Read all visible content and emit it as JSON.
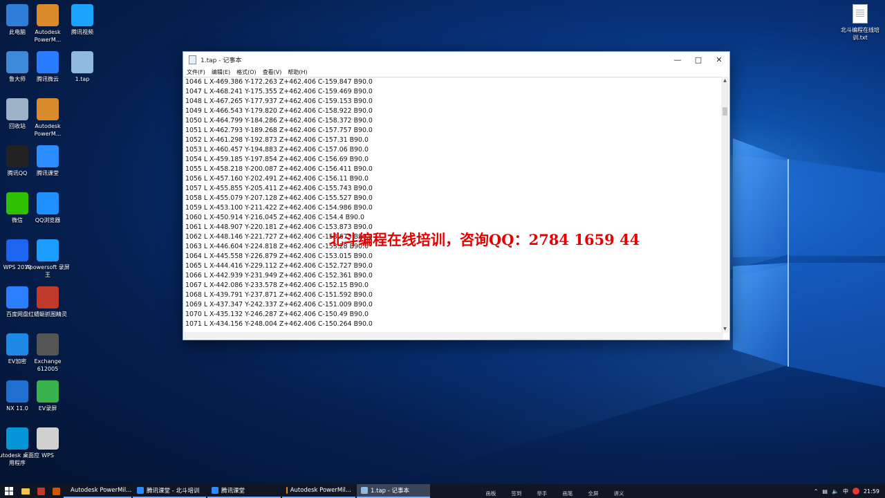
{
  "desktop_icons": [
    {
      "label": "此电脑",
      "icon": "computer-icon",
      "color": "#2e7dd7"
    },
    {
      "label": "Autodesk PowerM...",
      "icon": "powermill-icon",
      "color": "#d98a2a"
    },
    {
      "label": "腾讯视频",
      "icon": "tencent-video-icon",
      "color": "#1aa3ff"
    },
    {
      "label": "鲁大师",
      "icon": "ludashi-icon",
      "color": "#3c8ad8"
    },
    {
      "label": "腾讯微云",
      "icon": "weiyun-icon",
      "color": "#2a7cff"
    },
    {
      "label": "1.tap",
      "icon": "file-icon",
      "color": "#8fb9e0"
    },
    {
      "label": "回收站",
      "icon": "recycle-bin-icon",
      "color": "#9fb3c8"
    },
    {
      "label": "Autodesk PowerM...",
      "icon": "powermill-icon",
      "color": "#d98a2a"
    },
    {
      "label": "腾讯QQ",
      "icon": "qq-icon",
      "color": "#222222"
    },
    {
      "label": "腾讯课堂",
      "icon": "tencent-classroom-icon",
      "color": "#2a8cff"
    },
    {
      "label": "微信",
      "icon": "wechat-icon",
      "color": "#2dc100"
    },
    {
      "label": "QQ浏览器",
      "icon": "qq-browser-icon",
      "color": "#1e90ff"
    },
    {
      "label": "WPS 2019",
      "icon": "wps-icon",
      "color": "#1c64f2"
    },
    {
      "label": "Apowersoft 录屏王",
      "icon": "recorder-icon",
      "color": "#1a9dff"
    },
    {
      "label": "百度网盘",
      "icon": "baidu-netdisk-icon",
      "color": "#2a7fff"
    },
    {
      "label": "红蜻蜓抓图精灵",
      "icon": "dragonfly-icon",
      "color": "#c0392b"
    },
    {
      "label": "EV加密",
      "icon": "ev-encrypt-icon",
      "color": "#1e88e5"
    },
    {
      "label": "Exchange 612005",
      "icon": "exchange-icon",
      "color": "#555555"
    },
    {
      "label": "NX 11.0",
      "icon": "nx-icon",
      "color": "#1e6fd0"
    },
    {
      "label": "EV录屏",
      "icon": "ev-recorder-icon",
      "color": "#37b24d"
    },
    {
      "label": "Autodesk 桌面应用程序",
      "icon": "autodesk-icon",
      "color": "#0696d7"
    },
    {
      "label": "WPS",
      "icon": "wps-file-icon",
      "color": "#d0d0d0"
    }
  ],
  "desktop_file": {
    "label": "北斗编程在线培训.txt"
  },
  "notepad": {
    "title": "1.tap - 记事本",
    "menu": [
      "文件(F)",
      "编辑(E)",
      "格式(O)",
      "查看(V)",
      "帮助(H)"
    ],
    "lines": [
      "1046 L X-469.386 Y-172.263 Z+462.406 C-159.847 B90.0",
      "1047 L X-468.241 Y-175.355 Z+462.406 C-159.469 B90.0",
      "1048 L X-467.265 Y-177.937 Z+462.406 C-159.153 B90.0",
      "1049 L X-466.543 Y-179.820 Z+462.406 C-158.922 B90.0",
      "1050 L X-464.799 Y-184.286 Z+462.406 C-158.372 B90.0",
      "1051 L X-462.793 Y-189.268 Z+462.406 C-157.757 B90.0",
      "1052 L X-461.298 Y-192.873 Z+462.406 C-157.31 B90.0",
      "1053 L X-460.457 Y-194.883 Z+462.406 C-157.06 B90.0",
      "1054 L X-459.185 Y-197.854 Z+462.406 C-156.69 B90.0",
      "1055 L X-458.218 Y-200.087 Z+462.406 C-156.411 B90.0",
      "1056 L X-457.160 Y-202.491 Z+462.406 C-156.11 B90.0",
      "1057 L X-455.855 Y-205.411 Z+462.406 C-155.743 B90.0",
      "1058 L X-455.079 Y-207.128 Z+462.406 C-155.527 B90.0",
      "1059 L X-453.100 Y-211.422 Z+462.406 C-154.986 B90.0",
      "1060 L X-450.914 Y-216.045 Z+462.406 C-154.4 B90.0",
      "1061 L X-448.907 Y-220.181 Z+462.406 C-153.873 B90.0",
      "1062 L X-448.146 Y-221.727 Z+462.406 C-153.673 B90.0",
      "1063 L X-446.604 Y-224.818 Z+462.406 C-153.28 B90.0",
      "1064 L X-445.558 Y-226.879 Z+462.406 C-153.015 B90.0",
      "1065 L X-444.416 Y-229.112 Z+462.406 C-152.727 B90.0",
      "1066 L X-442.939 Y-231.949 Z+462.406 C-152.361 B90.0",
      "1067 L X-442.086 Y-233.578 Z+462.406 C-152.15 B90.0",
      "1068 L X-439.791 Y-237.871 Z+462.406 C-151.592 B90.0",
      "1069 L X-437.347 Y-242.337 Z+462.406 C-151.009 B90.0",
      "1070 L X-435.132 Y-246.287 Z+462.406 C-150.49 B90.0",
      "1071 L X-434.156 Y-248.004 Z+462.406 C-150.264 B90.0"
    ]
  },
  "watermark": "北斗编程在线培训，咨询QQ：2784 1659 44",
  "taskbar": {
    "tasks": [
      {
        "label": "Autodesk PowerMil...",
        "color": "#d98a2a",
        "active": false
      },
      {
        "label": "腾讯课堂 - 北斗培训",
        "color": "#2a8cff",
        "active": false
      },
      {
        "label": "腾讯课堂",
        "color": "#2a8cff",
        "active": false
      },
      {
        "label": "Autodesk PowerMil...",
        "color": "#d98a2a",
        "active": false
      },
      {
        "label": "1.tap - 记事本",
        "color": "#8fb9e0",
        "active": true
      }
    ],
    "ime": [
      "画板",
      "签到",
      "举手",
      "画笔",
      "全屏",
      "讲义"
    ],
    "tray_lang": "中",
    "clock": "21:59"
  }
}
